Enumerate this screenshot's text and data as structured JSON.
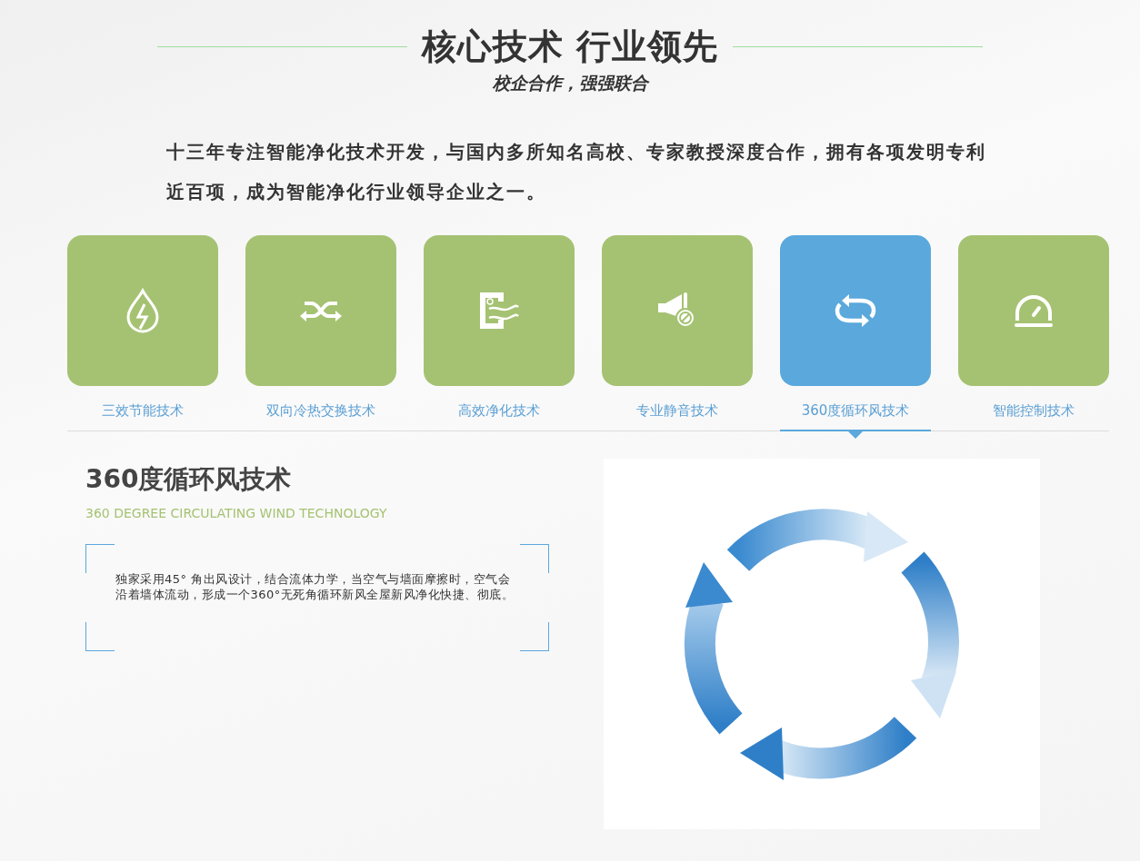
{
  "header": {
    "title": "核心技术 行业领先",
    "subtitle": "校企合作，强强联合"
  },
  "intro": "十三年专注智能净化技术开发，与国内多所知名高校、专家教授深度合作，拥有各项发明专利近百项，成为智能净化行业领导企业之一。",
  "tabs": [
    {
      "label": "三效节能技术",
      "kind": "drop",
      "selected": false
    },
    {
      "label": "双向冷热交换技术",
      "kind": "shuffle",
      "selected": false
    },
    {
      "label": "高效净化技术",
      "kind": "purifier",
      "selected": false
    },
    {
      "label": "专业静音技术",
      "kind": "mute",
      "selected": false
    },
    {
      "label": "360度循环风技术",
      "kind": "cycle",
      "selected": true
    },
    {
      "label": "智能控制技术",
      "kind": "gauge",
      "selected": false
    }
  ],
  "detail": {
    "title": "360度循环风技术",
    "subtitle": "360 DEGREE CIRCULATING WIND TECHNOLOGY",
    "description": "独家采用45° 角出风设计，结合流体力学，当空气与墙面摩擦时，空气会沿着墙体流动，形成一个360°无死角循环新风全屋新风净化快捷、彻底。"
  }
}
